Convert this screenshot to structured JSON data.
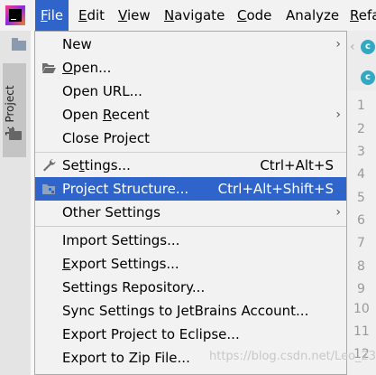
{
  "menubar": {
    "items": [
      {
        "label": "File",
        "mnemonic": "F",
        "rest": "ile"
      },
      {
        "label": "Edit",
        "mnemonic": "E",
        "rest": "dit"
      },
      {
        "label": "View",
        "mnemonic": "V",
        "rest": "iew"
      },
      {
        "label": "Navigate",
        "mnemonic": "N",
        "rest": "avigate"
      },
      {
        "label": "Code",
        "mnemonic": "C",
        "rest": "ode"
      },
      {
        "label": "Analyze",
        "mnemonic": "",
        "rest": "Analyze"
      },
      {
        "label": "Refa",
        "mnemonic": "R",
        "rest": "efa"
      }
    ]
  },
  "side": {
    "project_tab_label": "1: Project"
  },
  "editor": {
    "tab_icon_letter": "c",
    "line_numbers": [
      "1",
      "2",
      "3",
      "4",
      "5",
      "6",
      "7",
      "8",
      "9",
      "10",
      "11",
      "12"
    ]
  },
  "file_menu": {
    "items": [
      {
        "pre": "",
        "mn": "",
        "post": "New",
        "shortcut": "",
        "submenu": true
      },
      {
        "pre": "",
        "mn": "O",
        "post": "pen...",
        "shortcut": "",
        "submenu": false
      },
      {
        "pre": "Open URL...",
        "mn": "",
        "post": "",
        "shortcut": "",
        "submenu": false
      },
      {
        "pre": "Open ",
        "mn": "R",
        "post": "ecent",
        "shortcut": "",
        "submenu": true
      },
      {
        "pre": "Close Project",
        "mn": "",
        "post": "",
        "shortcut": "",
        "submenu": false
      },
      {
        "pre": "Se",
        "mn": "t",
        "post": "tings...",
        "shortcut": "Ctrl+Alt+S",
        "submenu": false
      },
      {
        "pre": "Project Structure...",
        "mn": "",
        "post": "",
        "shortcut": "Ctrl+Alt+Shift+S",
        "submenu": false
      },
      {
        "pre": "Other Settings",
        "mn": "",
        "post": "",
        "shortcut": "",
        "submenu": true
      },
      {
        "pre": "Import Settings...",
        "mn": "",
        "post": "",
        "shortcut": "",
        "submenu": false
      },
      {
        "pre": "",
        "mn": "E",
        "post": "xport Settings...",
        "shortcut": "",
        "submenu": false
      },
      {
        "pre": "Settings Repository...",
        "mn": "",
        "post": "",
        "shortcut": "",
        "submenu": false
      },
      {
        "pre": "Sync Settings to JetBrains Account...",
        "mn": "",
        "post": "",
        "shortcut": "",
        "submenu": false
      },
      {
        "pre": "Export Project to Eclipse...",
        "mn": "",
        "post": "",
        "shortcut": "",
        "submenu": false
      },
      {
        "pre": "Export to Zip File...",
        "mn": "",
        "post": "",
        "shortcut": "",
        "submenu": false
      }
    ],
    "submenu_arrow": "›"
  },
  "watermark": "https://blog.csdn.net/Leo_2330",
  "colors": {
    "selection": "#2f65ca",
    "menu_bg": "#f2f2f2",
    "tab_icon": "#34a7c1"
  }
}
